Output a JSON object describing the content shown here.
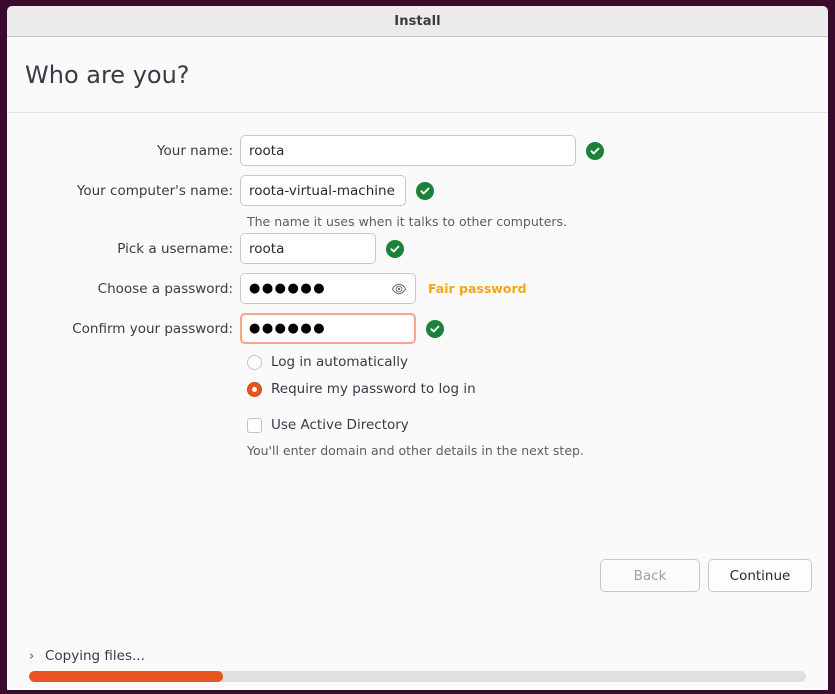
{
  "window": {
    "title": "Install",
    "frame_color": "#3a0b2c",
    "titlebar_color": "#ebebeb"
  },
  "page": {
    "heading": "Who are you?"
  },
  "form": {
    "fields": [
      {
        "label": "Your name:",
        "value": "roota",
        "valid": true,
        "icon": "check-circle-icon"
      },
      {
        "label": "Your computer's name:",
        "value": "roota-virtual-machine",
        "valid": true,
        "icon": "check-circle-icon",
        "hint": "The name it uses when it talks to other computers."
      },
      {
        "label": "Pick a username:",
        "value": "roota",
        "valid": true,
        "icon": "check-circle-icon"
      },
      {
        "label": "Choose a password:",
        "value": "●●●●●●",
        "reveal_icon": "eye-icon",
        "strength": "Fair password",
        "strength_color": "#f7a41b"
      },
      {
        "label": "Confirm your password:",
        "value": "●●●●●●",
        "focused": true,
        "valid": true,
        "icon": "check-circle-icon"
      }
    ],
    "login_options": [
      {
        "label": "Log in automatically",
        "selected": false
      },
      {
        "label": "Require my password to log in",
        "selected": true
      }
    ],
    "active_directory": {
      "label": "Use Active Directory",
      "checked": false,
      "hint": "You'll enter domain and other details in the next step."
    }
  },
  "actions": {
    "back_label": "Back",
    "back_enabled": false,
    "continue_label": "Continue",
    "continue_enabled": true
  },
  "status": {
    "expander_icon": "chevron-right-icon",
    "message": "Copying files...",
    "progress_percent": 25,
    "progress_color": "#e95420"
  }
}
